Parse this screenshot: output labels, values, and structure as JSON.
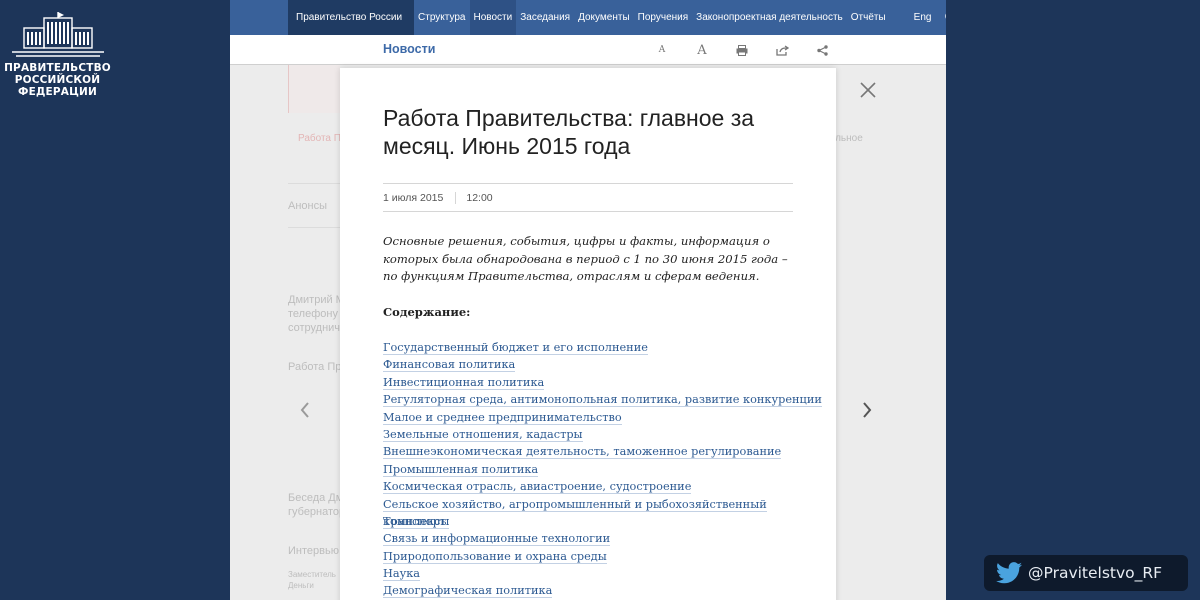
{
  "logo": {
    "lines": [
      "ПРАВИТЕЛЬСТВО",
      "РОССИЙСКОЙ",
      "ФЕДЕРАЦИИ"
    ]
  },
  "nav": {
    "brand": "Правительство России",
    "items": [
      "Структура",
      "Новости",
      "Заседания",
      "Документы",
      "Поручения",
      "Законопроектная деятельность",
      "Отчёты"
    ],
    "active_index": 1,
    "lang": "Eng"
  },
  "subbar": {
    "title": "Новости",
    "tools": [
      "font-smaller-icon",
      "font-larger-icon",
      "print-icon",
      "share-out-icon",
      "share-icon"
    ]
  },
  "background_ghost": {
    "announce_tab": "Анонсы",
    "item1": "Работа Пр",
    "item2": "Дмитрий М",
    "item2b": "телефону с",
    "item2c": "сотрудниче",
    "item3": "Работа Пр",
    "item4": "Беседа Дм",
    "item4b": "губернатор",
    "item5": "Интервью Д",
    "item6": "Заместитель",
    "item6b": "Деньги",
    "right1": "вльное"
  },
  "modal": {
    "title": "Работа Правительства: главное за месяц. Июнь 2015 года",
    "date": "1 июля 2015",
    "time": "12:00",
    "lead": "Основные решения, события, цифры и факты, информация о которых была обнародована в период с 1 по 30 июня 2015 года – по функциям Правительства, отраслям и сферам ведения.",
    "toc_heading": "Содержание:",
    "toc": [
      "Государственный бюджет и его исполнение",
      "Финансовая политика",
      "Инвестиционная политика",
      "Регуляторная среда, антимонопольная политика, развитие конкуренции",
      "Малое и среднее предпринимательство",
      "Земельные отношения, кадастры",
      "Внешнеэкономическая деятельность, таможенное регулирование",
      "Промышленная политика",
      "Космическая отрасль, авиастроение, судостроение",
      "Сельское хозяйство, агропромышленный и рыбохозяйственный комплексы",
      "Транспорт",
      "Связь и информационные технологии",
      "Природопользование и охрана среды",
      "Наука",
      "Демографическая политика"
    ]
  },
  "twitter": {
    "handle": "@Pravitelstvo_RF"
  },
  "colors": {
    "page_bg": "#1d3559",
    "nav_bg": "#39619a",
    "link": "#2d5a92",
    "title_blue": "#3d6aa8"
  }
}
